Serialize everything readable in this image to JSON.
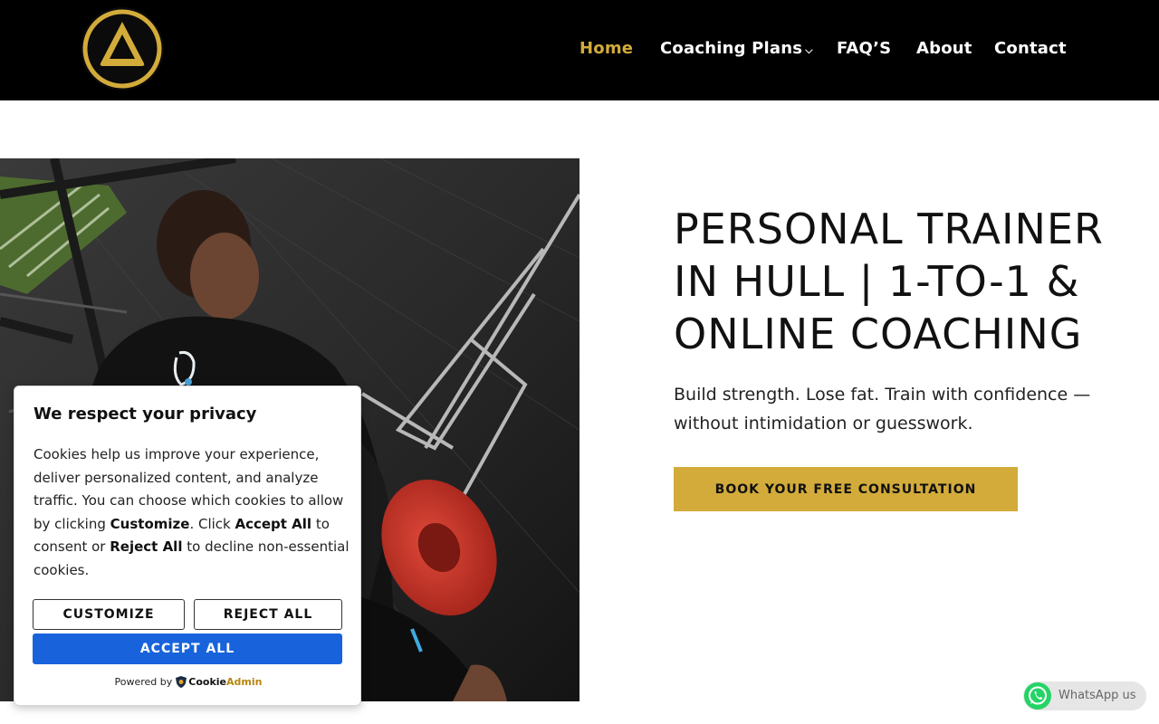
{
  "header": {
    "nav": {
      "home": "Home",
      "coaching_plans": "Coaching Plans",
      "faqs": "FAQ’S",
      "about": "About",
      "contact": "Contact"
    },
    "active_item": "Home"
  },
  "hero": {
    "title": "PERSONAL TRAINER IN HULL | 1-TO-1 & ONLINE COACHING",
    "subtitle": "Build strength. Lose fat. Train with confidence — without intimidation or guesswork.",
    "cta_label": "BOOK YOUR FREE CONSULTATION"
  },
  "cookie_banner": {
    "title": "We respect your privacy",
    "body": {
      "part1": "Cookies help us improve your experience, deliver personalized content, and analyze traffic. You can choose which cookies to allow by clicking ",
      "customize": "Customize",
      "part2": ". Click ",
      "accept_all": "Accept All",
      "part3": " to consent or ",
      "reject_all": "Reject All",
      "part4": " to decline non-essential cookies."
    },
    "customize_button": "CUSTOMIZE",
    "reject_button": "REJECT ALL",
    "accept_button": "ACCEPT ALL",
    "powered_by": "Powered by",
    "brand_part1": "Cookie",
    "brand_part2": "Admin"
  },
  "whatsapp": {
    "label": "WhatsApp us"
  },
  "colors": {
    "header_bg": "#000000",
    "accent_gold": "#d2ab3a",
    "accept_blue": "#1863dc",
    "whatsapp_green": "#25d366"
  },
  "icons": [
    "logo-triangle-icon",
    "chevron-down-icon",
    "whatsapp-icon",
    "cookieadmin-shield-icon"
  ]
}
